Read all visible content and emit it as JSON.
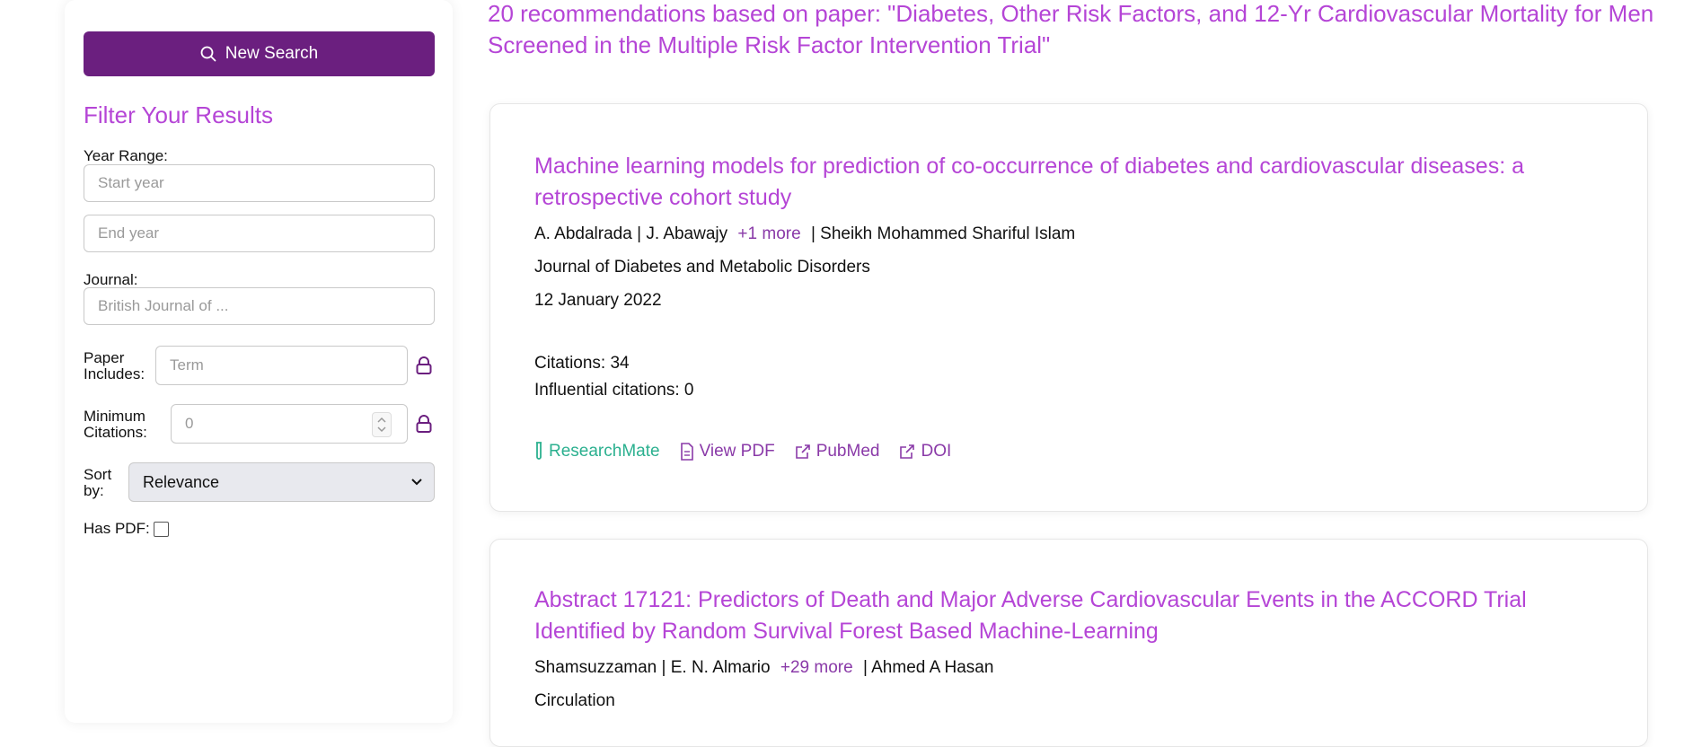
{
  "sidebar": {
    "new_search_label": "New Search",
    "filter_title": "Filter Your Results",
    "year_range_label": "Year Range:",
    "start_year_placeholder": "Start year",
    "end_year_placeholder": "End year",
    "journal_label": "Journal:",
    "journal_placeholder": "British Journal of ...",
    "paper_includes_label_1": "Paper",
    "paper_includes_label_2": "Includes:",
    "term_placeholder": "Term",
    "min_citations_label_1": "Minimum",
    "min_citations_label_2": "Citations:",
    "min_citations_placeholder": "0",
    "sort_label_1": "Sort",
    "sort_label_2": "by:",
    "sort_value": "Relevance",
    "has_pdf_label": "Has PDF:"
  },
  "header": {
    "title": "20 recommendations based on paper: \"Diabetes, Other Risk Factors, and 12-Yr Cardiovascular Mortality for Men Screened in the Multiple Risk Factor Intervention Trial\""
  },
  "results": [
    {
      "title": "Machine learning models for prediction of co-occurrence of diabetes and cardiovascular diseases: a retrospective cohort study",
      "author1": "A. Abdalrada |",
      "author2": "J. Abawajy",
      "more": "+1 more",
      "last_author": "| Sheikh Mohammed Shariful Islam",
      "journal": "Journal of Diabetes and Metabolic Disorders",
      "date": "12 January 2022",
      "citations": "Citations: 34",
      "influential": "Influential citations: 0",
      "links": {
        "researchmate": "ResearchMate",
        "pdf": "View PDF",
        "pubmed": "PubMed",
        "doi": "DOI"
      }
    },
    {
      "title": "Abstract 17121: Predictors of Death and Major Adverse Cardiovascular Events in the ACCORD Trial Identified by Random Survival Forest Based Machine-Learning",
      "author1": "Shamsuzzaman |",
      "author2": "E. N. Almario",
      "more": "+29 more",
      "last_author": "| Ahmed A Hasan",
      "journal": "Circulation"
    }
  ],
  "colors": {
    "accent": "#b545d6",
    "button": "#6b1f7f",
    "researchmate": "#2bb08f"
  }
}
